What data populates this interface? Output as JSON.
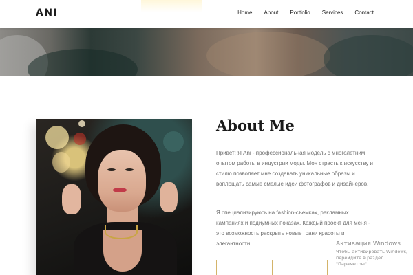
{
  "header": {
    "logo": "ANI",
    "nav": [
      "Home",
      "About",
      "Portfolio",
      "Services",
      "Contact"
    ]
  },
  "about": {
    "title": "About Me",
    "paragraph1": "Привет! Я Ani - профессиональная модель с многолетним опытом работы в индустрии моды. Моя страсть к искусству и стилю позволяет мне создавать уникальные образы и воплощать самые смелые идеи фотографов и дизайнеров.",
    "paragraph2": "Я специализируюсь на fashion-съемках, рекламных кампаниях и подиумных показах. Каждый проект для меня - это возможность раскрыть новые грани красоты и элегантности."
  },
  "watermark": {
    "title": "Активация Windows",
    "subtitle": "Чтобы активировать Windows, перейдите в раздел \"Параметры\"."
  },
  "colors": {
    "accent": "#d4b46a",
    "text_dark": "#1a1a1a",
    "text_muted": "#6e6e6e"
  }
}
